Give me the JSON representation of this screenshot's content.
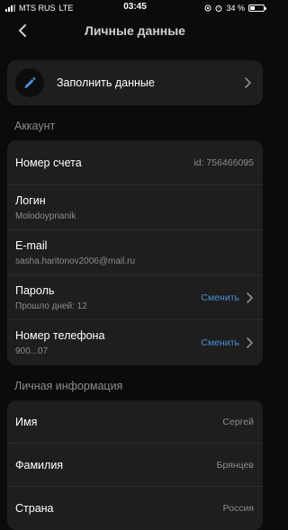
{
  "status": {
    "carrier": "MTS RUS",
    "network": "LTE",
    "time": "03:45",
    "battery_percent": 34,
    "battery_label": "34 %"
  },
  "navbar": {
    "title": "Личные данные"
  },
  "fill_card": {
    "label": "Заполнить данные"
  },
  "account": {
    "section_title": "Аккаунт",
    "account_number": {
      "label": "Номер счета",
      "value": "id: 756466095"
    },
    "login": {
      "label": "Логин",
      "value": "Molodoyprianik"
    },
    "email": {
      "label": "E-mail",
      "value": "sasha.haritonov2006@mail.ru"
    },
    "password": {
      "label": "Пароль",
      "sub": "Прошло дней: 12",
      "action": "Сменить"
    },
    "phone": {
      "label": "Номер телефона",
      "sub": "900...07",
      "action": "Сменить"
    }
  },
  "personal": {
    "section_title": "Личная информация",
    "first_name": {
      "label": "Имя",
      "value": "Сергей"
    },
    "last_name": {
      "label": "Фамилия",
      "value": "Брянцев"
    },
    "country": {
      "label": "Страна",
      "value": "Россия"
    }
  },
  "colors": {
    "accent": "#4a8fd6",
    "card_bg": "#1e1e1e",
    "page_bg": "#0b0b0b"
  }
}
